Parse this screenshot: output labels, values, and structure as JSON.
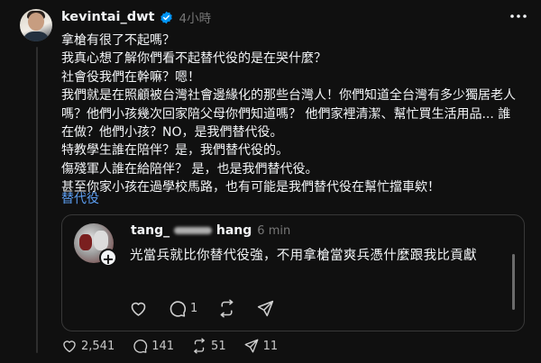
{
  "post": {
    "username": "kevintai_dwt",
    "time": "4小時",
    "lines": [
      "拿槍有很了不起嗎？",
      "我真心想了解你們看不起替代役的是在哭什麼？",
      "社會役我們在幹嘛？嗯！",
      "我們就是在照顧被台灣社會邊緣化的那些台灣人！你們知道全台灣有多少獨居老人",
      "嗎？他們小孩幾次回家陪父母你們知道嗎？ 他們家裡清潔、幫忙買生活用品... 誰",
      "在做？他們小孩？NO，是我們替代役。",
      "特教學生誰在陪伴？是，我們替代役的。",
      "傷殘軍人誰在給陪伴？ 是，也是我們替代役。",
      "甚至你家小孩在過學校馬路，也有可能是我們替代役在幫忙擋車欸！"
    ],
    "translate": "替代役",
    "actions": {
      "likes": "2,541",
      "comments": "141",
      "reposts": "51",
      "shares": "11"
    }
  },
  "quote": {
    "name_prefix": "tang_",
    "name_suffix": "hang",
    "time": "6 min",
    "text": "光當兵就比你替代役強，不用拿槍當爽兵憑什麼跟我比貢獻",
    "comments": "1"
  },
  "colors": {
    "background": "#101010",
    "text": "#f3f5f7",
    "muted": "#777777",
    "link": "#5b9df0",
    "verified": "#0095f6"
  }
}
